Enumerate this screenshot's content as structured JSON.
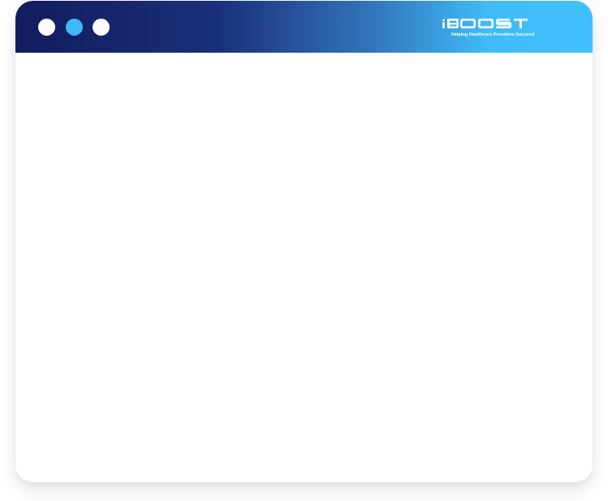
{
  "window": {
    "controls": [
      {
        "icon": "window-dot-icon",
        "color": "#ffffff"
      },
      {
        "icon": "window-dot-icon",
        "color": "#3fb8f5"
      },
      {
        "icon": "window-dot-icon",
        "color": "#ffffff"
      }
    ],
    "titlebar_gradient": [
      "#121c5e",
      "#3276bc",
      "#40c0fb"
    ]
  },
  "brand": {
    "logo_text": "iBOOST",
    "tagline": "Helping Healthcare Providers Succeed",
    "color": "#ffffff"
  },
  "content": {
    "background": "#ffffff"
  }
}
